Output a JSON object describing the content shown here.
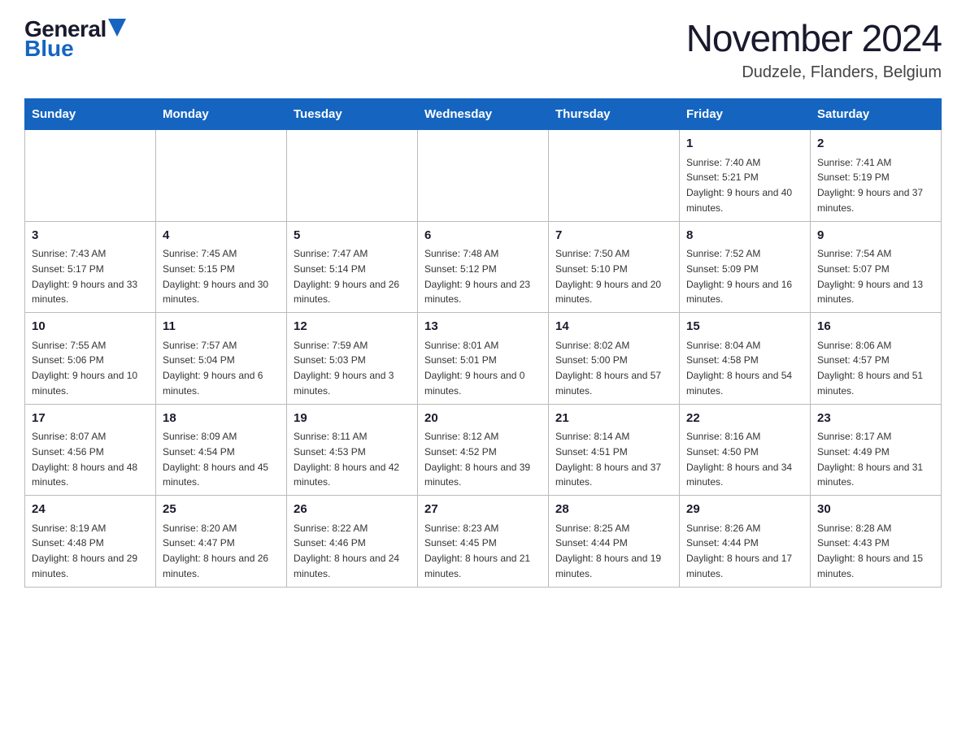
{
  "header": {
    "logo_general": "General",
    "logo_blue": "Blue",
    "month_year": "November 2024",
    "location": "Dudzele, Flanders, Belgium"
  },
  "days_of_week": [
    "Sunday",
    "Monday",
    "Tuesday",
    "Wednesday",
    "Thursday",
    "Friday",
    "Saturday"
  ],
  "weeks": [
    [
      {
        "day": "",
        "info": ""
      },
      {
        "day": "",
        "info": ""
      },
      {
        "day": "",
        "info": ""
      },
      {
        "day": "",
        "info": ""
      },
      {
        "day": "",
        "info": ""
      },
      {
        "day": "1",
        "info": "Sunrise: 7:40 AM\nSunset: 5:21 PM\nDaylight: 9 hours and 40 minutes."
      },
      {
        "day": "2",
        "info": "Sunrise: 7:41 AM\nSunset: 5:19 PM\nDaylight: 9 hours and 37 minutes."
      }
    ],
    [
      {
        "day": "3",
        "info": "Sunrise: 7:43 AM\nSunset: 5:17 PM\nDaylight: 9 hours and 33 minutes."
      },
      {
        "day": "4",
        "info": "Sunrise: 7:45 AM\nSunset: 5:15 PM\nDaylight: 9 hours and 30 minutes."
      },
      {
        "day": "5",
        "info": "Sunrise: 7:47 AM\nSunset: 5:14 PM\nDaylight: 9 hours and 26 minutes."
      },
      {
        "day": "6",
        "info": "Sunrise: 7:48 AM\nSunset: 5:12 PM\nDaylight: 9 hours and 23 minutes."
      },
      {
        "day": "7",
        "info": "Sunrise: 7:50 AM\nSunset: 5:10 PM\nDaylight: 9 hours and 20 minutes."
      },
      {
        "day": "8",
        "info": "Sunrise: 7:52 AM\nSunset: 5:09 PM\nDaylight: 9 hours and 16 minutes."
      },
      {
        "day": "9",
        "info": "Sunrise: 7:54 AM\nSunset: 5:07 PM\nDaylight: 9 hours and 13 minutes."
      }
    ],
    [
      {
        "day": "10",
        "info": "Sunrise: 7:55 AM\nSunset: 5:06 PM\nDaylight: 9 hours and 10 minutes."
      },
      {
        "day": "11",
        "info": "Sunrise: 7:57 AM\nSunset: 5:04 PM\nDaylight: 9 hours and 6 minutes."
      },
      {
        "day": "12",
        "info": "Sunrise: 7:59 AM\nSunset: 5:03 PM\nDaylight: 9 hours and 3 minutes."
      },
      {
        "day": "13",
        "info": "Sunrise: 8:01 AM\nSunset: 5:01 PM\nDaylight: 9 hours and 0 minutes."
      },
      {
        "day": "14",
        "info": "Sunrise: 8:02 AM\nSunset: 5:00 PM\nDaylight: 8 hours and 57 minutes."
      },
      {
        "day": "15",
        "info": "Sunrise: 8:04 AM\nSunset: 4:58 PM\nDaylight: 8 hours and 54 minutes."
      },
      {
        "day": "16",
        "info": "Sunrise: 8:06 AM\nSunset: 4:57 PM\nDaylight: 8 hours and 51 minutes."
      }
    ],
    [
      {
        "day": "17",
        "info": "Sunrise: 8:07 AM\nSunset: 4:56 PM\nDaylight: 8 hours and 48 minutes."
      },
      {
        "day": "18",
        "info": "Sunrise: 8:09 AM\nSunset: 4:54 PM\nDaylight: 8 hours and 45 minutes."
      },
      {
        "day": "19",
        "info": "Sunrise: 8:11 AM\nSunset: 4:53 PM\nDaylight: 8 hours and 42 minutes."
      },
      {
        "day": "20",
        "info": "Sunrise: 8:12 AM\nSunset: 4:52 PM\nDaylight: 8 hours and 39 minutes."
      },
      {
        "day": "21",
        "info": "Sunrise: 8:14 AM\nSunset: 4:51 PM\nDaylight: 8 hours and 37 minutes."
      },
      {
        "day": "22",
        "info": "Sunrise: 8:16 AM\nSunset: 4:50 PM\nDaylight: 8 hours and 34 minutes."
      },
      {
        "day": "23",
        "info": "Sunrise: 8:17 AM\nSunset: 4:49 PM\nDaylight: 8 hours and 31 minutes."
      }
    ],
    [
      {
        "day": "24",
        "info": "Sunrise: 8:19 AM\nSunset: 4:48 PM\nDaylight: 8 hours and 29 minutes."
      },
      {
        "day": "25",
        "info": "Sunrise: 8:20 AM\nSunset: 4:47 PM\nDaylight: 8 hours and 26 minutes."
      },
      {
        "day": "26",
        "info": "Sunrise: 8:22 AM\nSunset: 4:46 PM\nDaylight: 8 hours and 24 minutes."
      },
      {
        "day": "27",
        "info": "Sunrise: 8:23 AM\nSunset: 4:45 PM\nDaylight: 8 hours and 21 minutes."
      },
      {
        "day": "28",
        "info": "Sunrise: 8:25 AM\nSunset: 4:44 PM\nDaylight: 8 hours and 19 minutes."
      },
      {
        "day": "29",
        "info": "Sunrise: 8:26 AM\nSunset: 4:44 PM\nDaylight: 8 hours and 17 minutes."
      },
      {
        "day": "30",
        "info": "Sunrise: 8:28 AM\nSunset: 4:43 PM\nDaylight: 8 hours and 15 minutes."
      }
    ]
  ]
}
